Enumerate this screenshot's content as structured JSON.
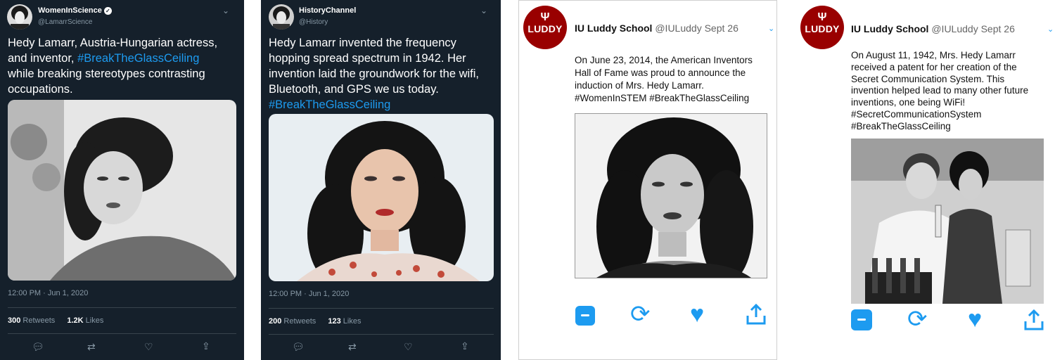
{
  "tweets": [
    {
      "user": "WomenInScience",
      "handle": "@LamarrScience",
      "text_lines": [
        "Hedy Lamarr, Austria-Hungarian actress,",
        "and inventor, ",
        "while breaking stereotypes contrasting",
        "occupations."
      ],
      "hashtag": "#BreakTheGlassCeiling",
      "time": "12:00 PM · Jun 1, 2020",
      "retweets": "300",
      "retweets_label": "Retweets",
      "likes": "1.2K",
      "likes_label": "Likes"
    },
    {
      "user": "HistoryChannel",
      "handle": "@History",
      "text_lines": [
        "Hedy Lamarr invented the frequency",
        "hopping spread spectrum in 1942. Her",
        "invention laid the groundwork for the wifi,",
        "Bluetooth, and GPS we us today."
      ],
      "hashtag": "#BreakTheGlassCeiling",
      "time": "12:00 PM · Jun 1, 2020",
      "retweets": "200",
      "retweets_label": "Retweets",
      "likes": "123",
      "likes_label": "Likes"
    },
    {
      "logo_text": "LUDDY",
      "user": "IU Luddy School",
      "meta": "@IULuddy Sept 26",
      "text_lines": [
        "On June 23, 2014, the American Inventors",
        "Hall of Fame was proud to announce the",
        "induction of Mrs. Hedy Lamarr.",
        "#WomenInSTEM #BreakTheGlassCeiling"
      ]
    },
    {
      "logo_text": "LUDDY",
      "user": "IU Luddy School",
      "meta": "@IULuddy Sept 26",
      "text_lines": [
        "On August 11, 1942, Mrs. Hedy Lamarr",
        "received a patent for her creation of the",
        "Secret Communication System. This",
        "invention helped lead to many other future",
        "inventions, one being WiFi!",
        "#SecretCommunicationSystem",
        "#BreakTheGlassCeiling"
      ]
    }
  ],
  "icons": [
    "chevron-down-icon",
    "verified-icon",
    "reply-icon",
    "retweet-icon",
    "like-icon",
    "share-icon",
    "comment-icon",
    "trident-icon"
  ],
  "colors": {
    "dark_bg": "#15202b",
    "link": "#1d9bf0",
    "muted": "#8899a6",
    "iu_crimson": "#990000"
  }
}
